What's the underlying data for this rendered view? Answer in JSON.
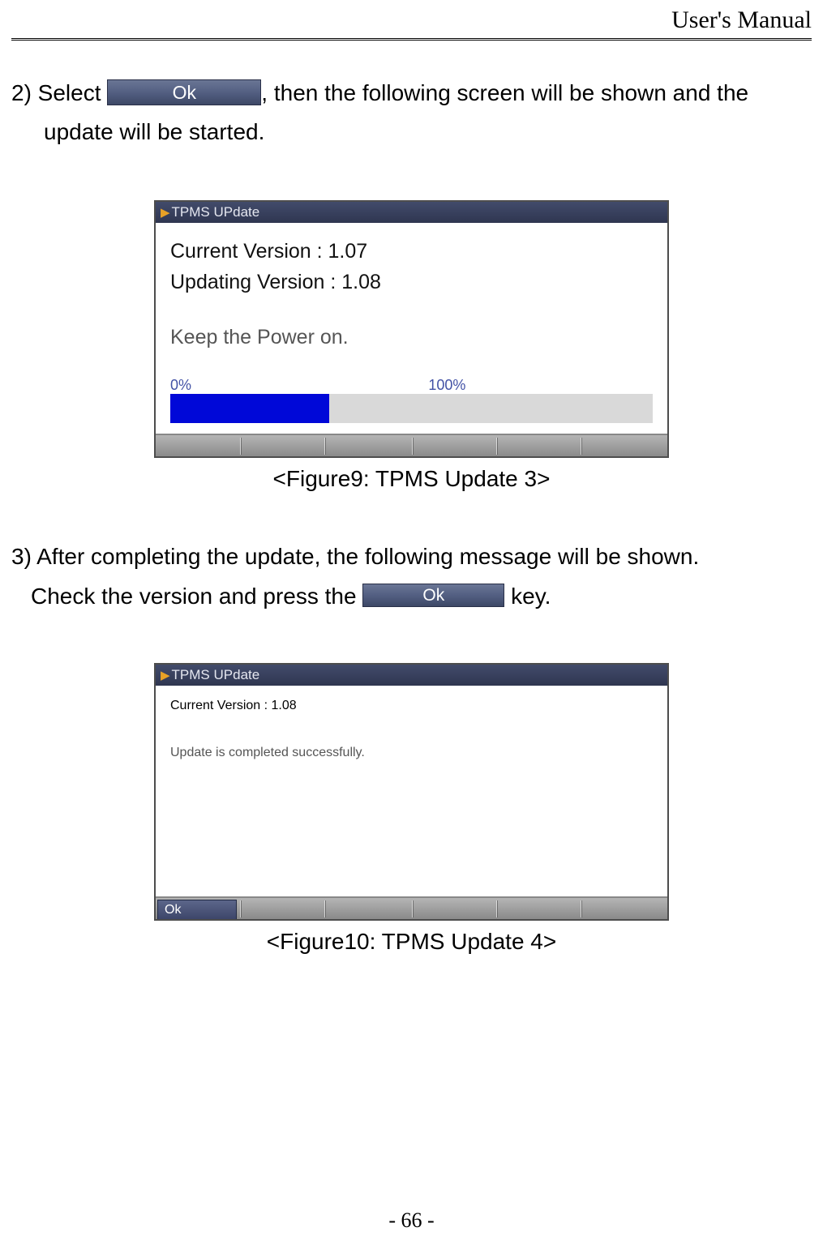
{
  "header": {
    "title": "User's Manual"
  },
  "page_number": "- 66 -",
  "step2": {
    "prefix": "2) Select ",
    "ok_label": "Ok",
    "suffix": ", then the following screen will be shown and the",
    "line2": "update will be started."
  },
  "figure9": {
    "titlebar": "TPMS UPdate",
    "line1": "Current Version : 1.07",
    "line2": "Updating Version : 1.08",
    "line3": "Keep the Power on.",
    "progress_0": "0%",
    "progress_100": "100%",
    "caption": "<Figure9: TPMS Update 3>"
  },
  "step3": {
    "line1": "3) After completing the update, the following message will be shown.",
    "line2_prefix": "Check the version and press the ",
    "ok_label": "Ok",
    "line2_suffix": " key."
  },
  "figure10": {
    "titlebar": "TPMS UPdate",
    "line1": "Current Version : 1.08",
    "line2": "Update is completed successfully.",
    "softkey_ok": "Ok",
    "caption": "<Figure10: TPMS Update 4>"
  }
}
